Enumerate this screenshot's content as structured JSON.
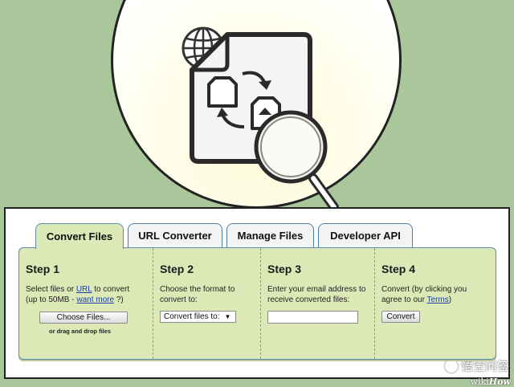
{
  "illustration": {
    "circle_fill": "#fffde9",
    "icons": [
      "globe-icon",
      "document-icon",
      "convert-arrows-icon",
      "magnifier-icon"
    ]
  },
  "tabs": [
    {
      "label": "Convert Files",
      "active": true
    },
    {
      "label": "URL Converter",
      "active": false
    },
    {
      "label": "Manage Files",
      "active": false
    },
    {
      "label": "Developer API",
      "active": false
    }
  ],
  "steps": {
    "step1": {
      "title": "Step 1",
      "desc_prefix": "Select files or ",
      "url_link": "URL",
      "desc_mid": " to convert",
      "desc_line2_prefix": "(up to 50MB - ",
      "want_more_link": "want more",
      "desc_line2_suffix": " ?)",
      "button": "Choose Files...",
      "drag_note": "or drag and drop files"
    },
    "step2": {
      "title": "Step 2",
      "desc": "Choose the format to convert to:",
      "select_value": "Convert files to:"
    },
    "step3": {
      "title": "Step 3",
      "desc": "Enter your email address to receive converted files:",
      "email_value": ""
    },
    "step4": {
      "title": "Step 4",
      "desc_prefix": "Convert (by clicking you agree to our ",
      "terms_link": "Terms",
      "desc_suffix": ")",
      "button": "Convert"
    }
  },
  "watermark": {
    "text": "悟空问答",
    "brand_prefix": "wiki",
    "brand_suffix": "How"
  },
  "colors": {
    "background": "#a9c79b",
    "tab_active": "#dce9b6",
    "tab_border": "#4b7da4",
    "link": "#1a3fb0"
  }
}
